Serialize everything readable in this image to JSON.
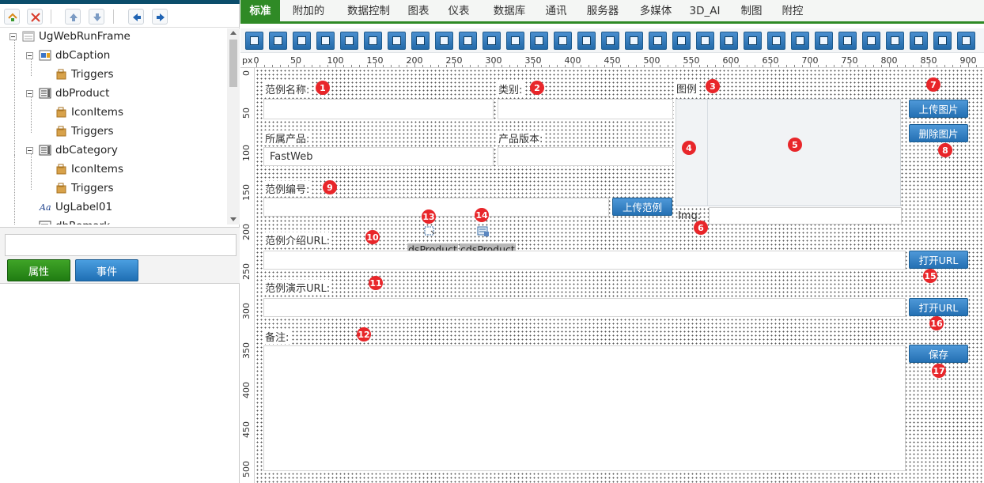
{
  "tree": {
    "items": [
      {
        "label": "UgWebRunFrame",
        "icon": "frame-icon"
      },
      {
        "label": "dbCaption",
        "icon": "caption-component-icon"
      },
      {
        "label": "Triggers",
        "icon": "triggers-folder-icon"
      },
      {
        "label": "dbProduct",
        "icon": "combobox-component-icon"
      },
      {
        "label": "IconItems",
        "icon": "iconitems-folder-icon"
      },
      {
        "label": "Triggers",
        "icon": "triggers-folder-icon"
      },
      {
        "label": "dbCategory",
        "icon": "combobox-component-icon"
      },
      {
        "label": "IconItems",
        "icon": "iconitems-folder-icon"
      },
      {
        "label": "Triggers",
        "icon": "triggers-folder-icon"
      },
      {
        "label": "UgLabel01",
        "icon": "label-component-icon"
      },
      {
        "label": "dbRemark",
        "icon": "memo-component-icon"
      }
    ]
  },
  "panel_tabs": {
    "properties": "属性",
    "events": "事件"
  },
  "menu": {
    "items": [
      "标准",
      "附加的",
      "数据控制",
      "图表",
      "仪表",
      "数据库",
      "通讯",
      "服务器",
      "多媒体",
      "3D_AI",
      "制图",
      "附控"
    ],
    "active_index": 0
  },
  "ruler": {
    "unit": "px",
    "top_labels": [
      "0",
      "50",
      "100",
      "150",
      "200",
      "250",
      "300",
      "350",
      "400",
      "450",
      "500",
      "550",
      "600",
      "650",
      "700",
      "750",
      "800",
      "850",
      "900"
    ],
    "left_labels": [
      "0",
      "50",
      "100",
      "150",
      "200",
      "250",
      "300",
      "350",
      "400",
      "450",
      "500"
    ]
  },
  "form": {
    "name_label": "范例名称:",
    "category_label": "类别:",
    "image_label": "图例",
    "product_label": "所属产品:",
    "product_value": "FastWeb",
    "version_label": "产品版本:",
    "number_label": "范例编号:",
    "upload_example_button": "上传范例",
    "intro_url_label": "范例介绍URL:",
    "demo_url_label": "范例演示URL:",
    "remark_label": "备注:",
    "img_label": "Img:",
    "upload_image_button": "上传图片",
    "delete_image_button": "删除图片",
    "open_url_button_1": "打开URL",
    "open_url_button_2": "打开URL",
    "save_button": "保存",
    "dataset_label": "dsProduct",
    "clientdataset_label": "cdsProduct"
  },
  "badges": [
    "1",
    "2",
    "3",
    "4",
    "5",
    "6",
    "7",
    "8",
    "9",
    "10",
    "11",
    "12",
    "13",
    "14",
    "15",
    "16",
    "17"
  ],
  "colors": {
    "menu_active": "#2f8a26",
    "button_blue": "#2470b3",
    "badge_red": "#e8262a",
    "left_top_bar": "#0b4d6b"
  }
}
